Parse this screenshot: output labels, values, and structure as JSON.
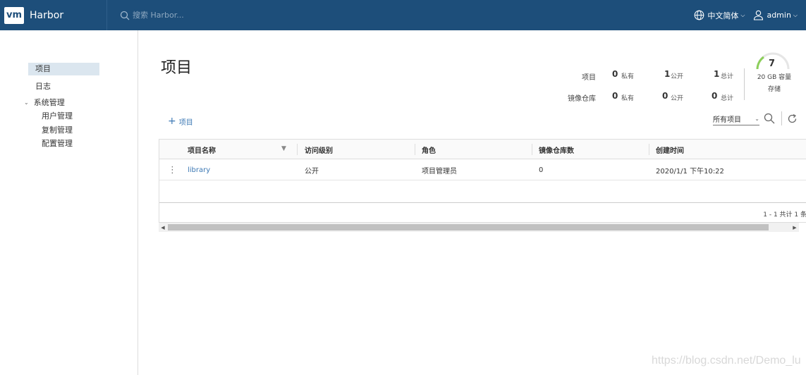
{
  "header": {
    "logo_text": "vm",
    "app_name": "Harbor",
    "search_placeholder": "搜索 Harbor...",
    "language": "中文简体",
    "user": "admin",
    "bg_color": "#1d4e7a"
  },
  "sidebar": {
    "items": [
      {
        "label": "项目",
        "active": true
      },
      {
        "label": "日志"
      },
      {
        "label": "系统管理",
        "expanded": true
      },
      {
        "label": "用户管理"
      },
      {
        "label": "复制管理"
      },
      {
        "label": "配置管理"
      }
    ]
  },
  "main": {
    "title": "项目",
    "stats": {
      "row1_label": "项目",
      "row2_label": "镜像仓库",
      "row1": [
        {
          "num": "0",
          "unit": "私有"
        },
        {
          "num": "1",
          "unit": "公开"
        },
        {
          "num": "1",
          "unit": "总计"
        }
      ],
      "row2": [
        {
          "num": "0",
          "unit": "私有"
        },
        {
          "num": "0",
          "unit": "公开"
        },
        {
          "num": "0",
          "unit": "总计"
        }
      ],
      "storage_gauge_value": "7",
      "storage_capacity": "20 GB 容量",
      "storage_label": "存储"
    },
    "add_project_label": "项目",
    "filter_value": "所有项目",
    "table": {
      "columns": [
        "项目名称",
        "访问级别",
        "角色",
        "镜像仓库数",
        "创建时间"
      ],
      "rows": [
        {
          "name": "library",
          "access": "公开",
          "role": "项目管理员",
          "repo_count": "0",
          "created": "2020/1/1 下午10:22"
        }
      ],
      "footer": "1 - 1 共计 1 条"
    }
  },
  "watermark": "https://blog.csdn.net/Demo_lu"
}
